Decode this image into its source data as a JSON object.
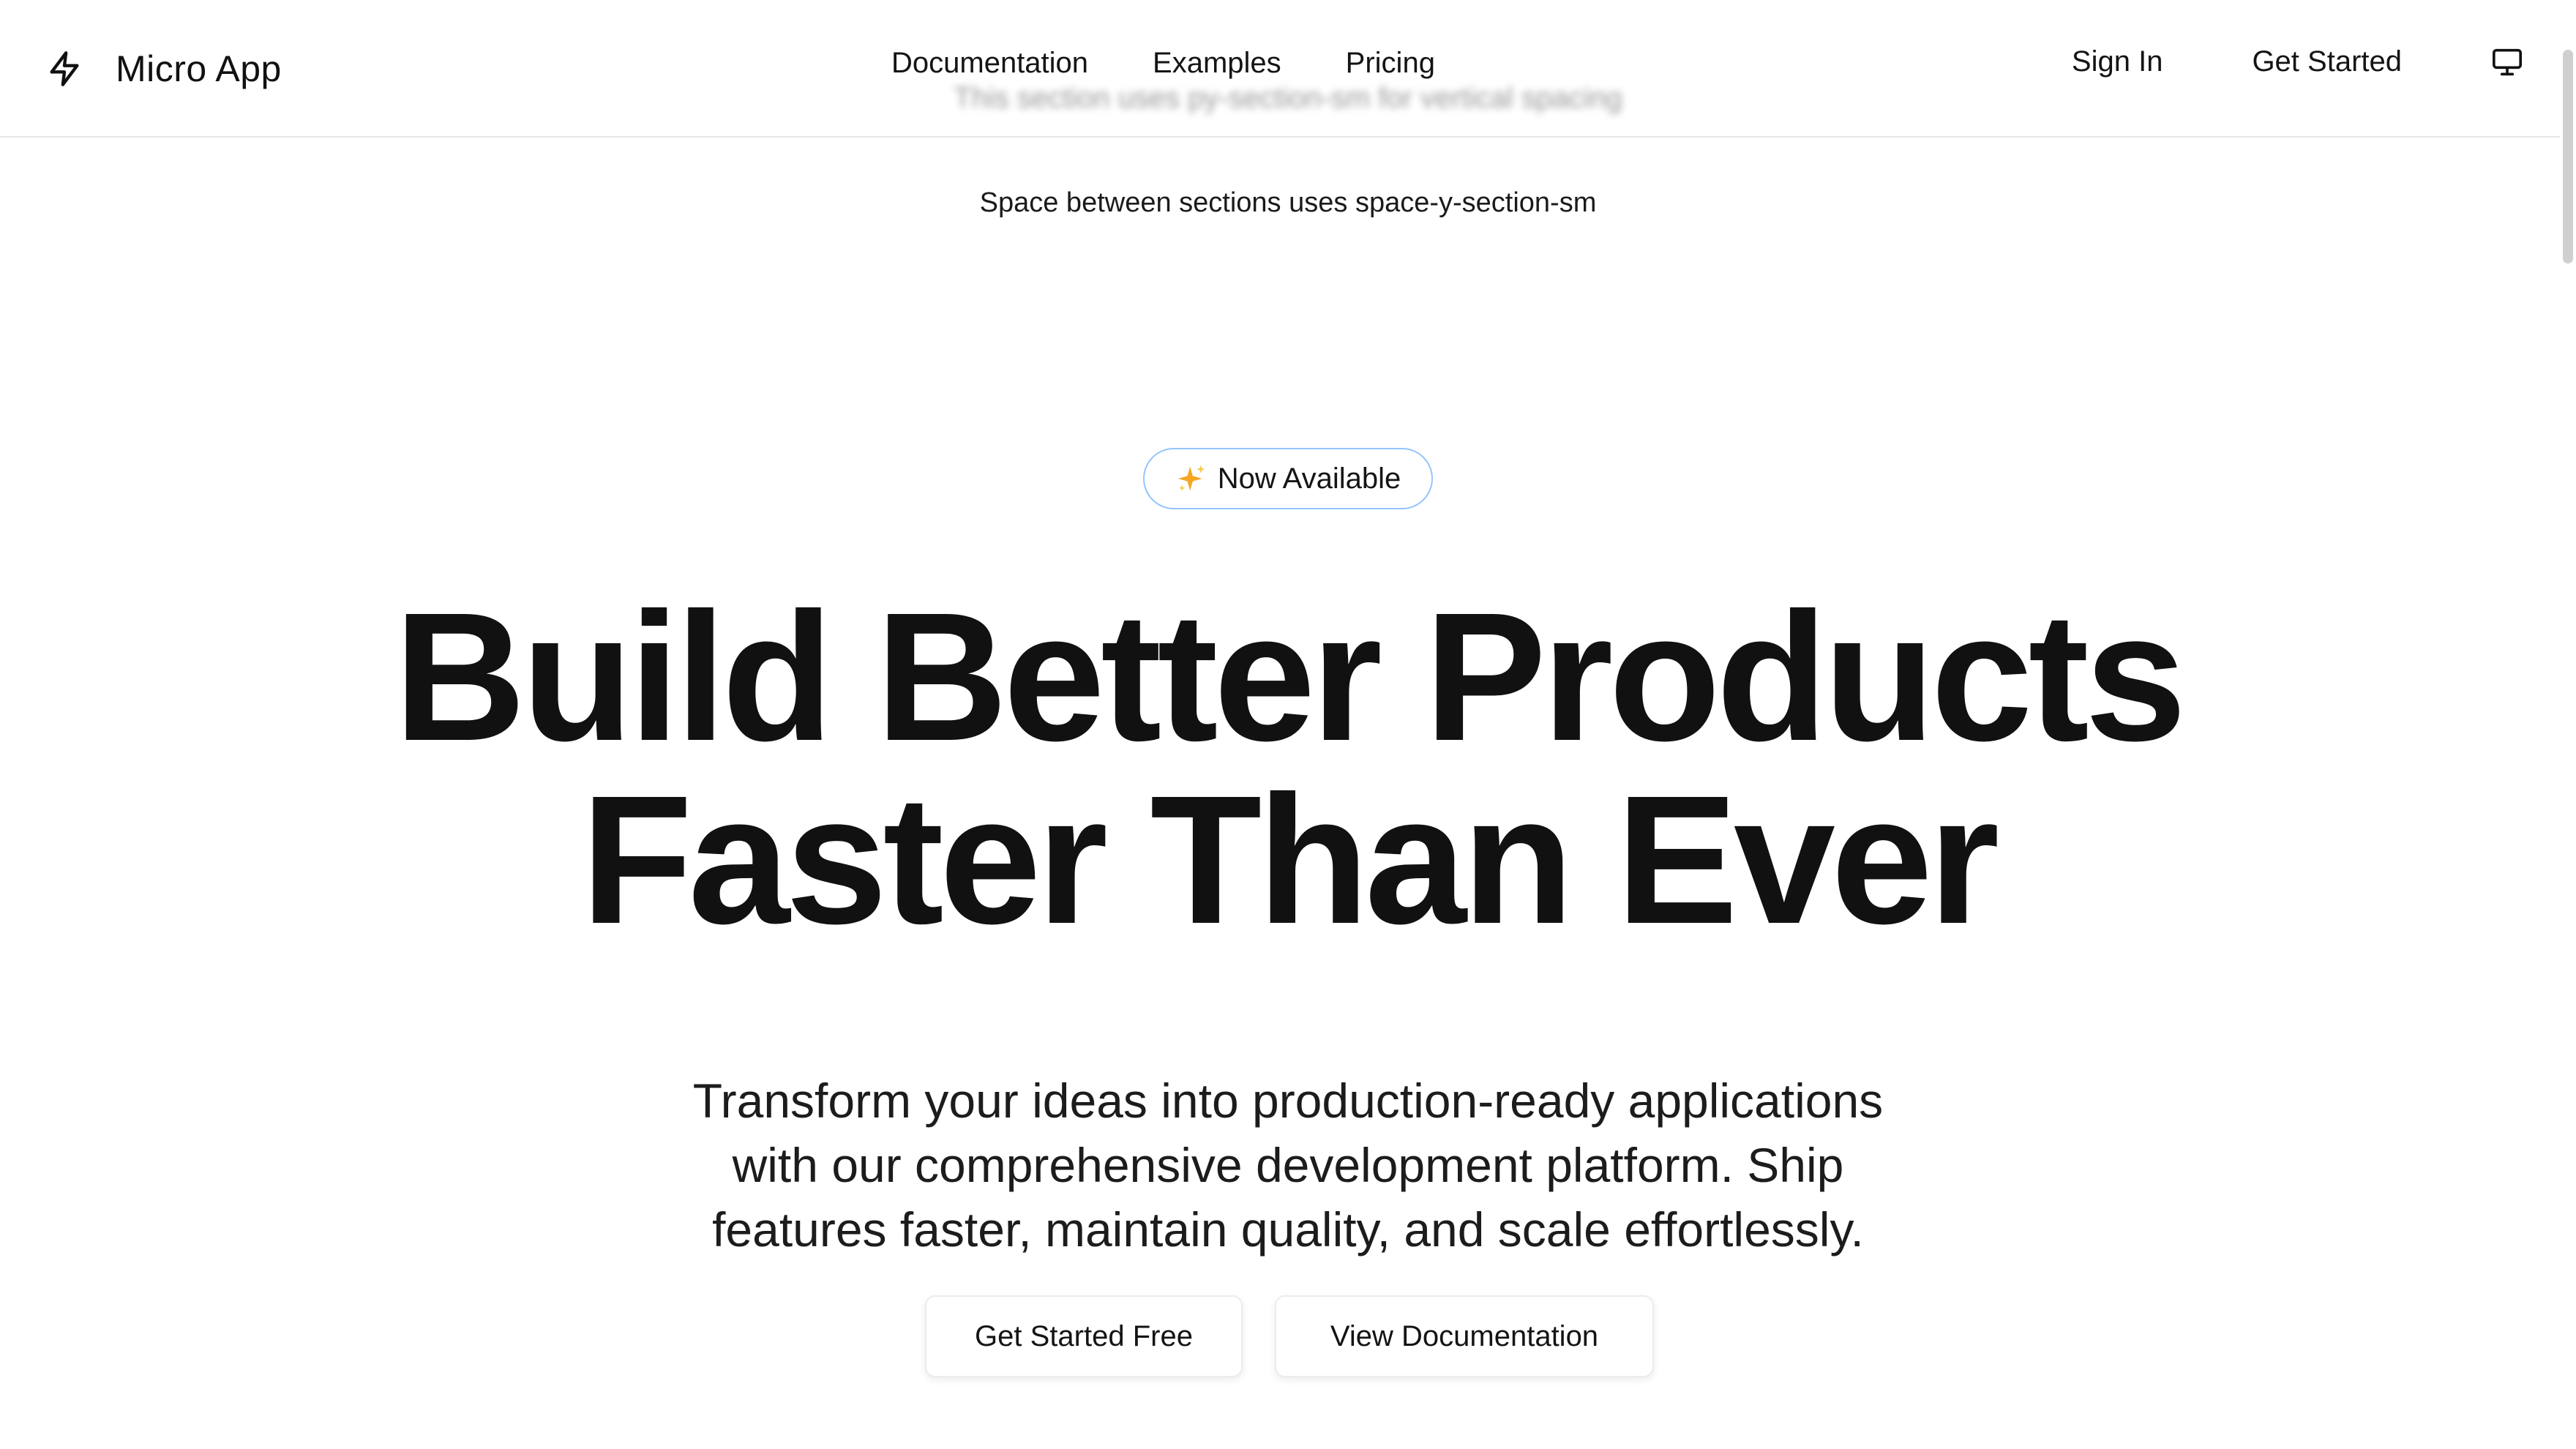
{
  "navbar": {
    "brand": {
      "icon": "lightning-bolt-icon",
      "name": "Micro App"
    },
    "links": [
      {
        "label": "Documentation"
      },
      {
        "label": "Examples"
      },
      {
        "label": "Pricing"
      }
    ],
    "sign_in_label": "Sign In",
    "get_started_label": "Get Started",
    "display_toggle_icon": "monitor-icon"
  },
  "blurred_caption": "This section uses py-section-sm for vertical spacing",
  "section_caption": "Space between sections uses space-y-section-sm",
  "badge": {
    "icon": "sparkles-icon",
    "label": "Now Available"
  },
  "hero": {
    "title_lines": [
      "Build Better Products",
      "Faster Than Ever"
    ],
    "subtitle_lines": [
      "Transform your ideas into production-ready applications",
      "with our comprehensive development platform. Ship",
      "features faster, maintain quality, and scale effortlessly."
    ],
    "primary_cta": "Get Started Free",
    "secondary_cta": "View Documentation"
  },
  "colors": {
    "text": "#111111",
    "badge_border": "#93c5fd",
    "sparkle": "#f5a623",
    "divider": "#e6e6e6"
  }
}
